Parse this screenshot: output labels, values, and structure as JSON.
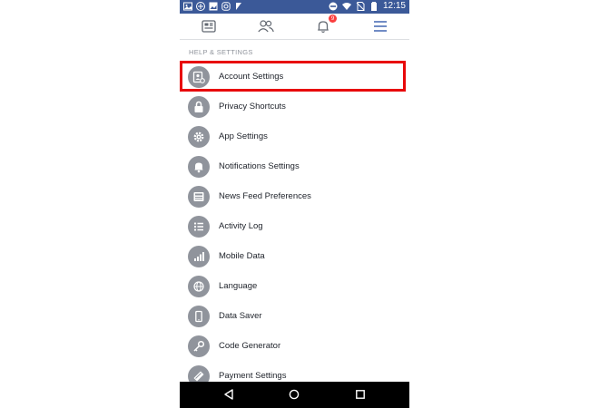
{
  "status_bar": {
    "time": "12:15",
    "left_icons": [
      "gallery-icon",
      "game-icon",
      "photo-icon",
      "instagram-icon",
      "download-icon"
    ],
    "right_icons": [
      "do-not-disturb-icon",
      "wifi-icon",
      "no-sim-icon",
      "battery-icon"
    ]
  },
  "nav": {
    "items": [
      {
        "name": "news-feed-tab",
        "icon": "news-feed-icon"
      },
      {
        "name": "friends-tab",
        "icon": "friends-icon"
      },
      {
        "name": "notifications-tab",
        "icon": "bell-icon",
        "badge": "9"
      },
      {
        "name": "menu-tab",
        "icon": "hamburger-menu-icon",
        "active": true
      }
    ],
    "active_color": "#4267b2"
  },
  "section": {
    "title": "HELP & SETTINGS"
  },
  "menu": {
    "items": [
      {
        "label": "Account Settings",
        "icon": "account-settings-icon"
      },
      {
        "label": "Privacy Shortcuts",
        "icon": "lock-icon"
      },
      {
        "label": "App Settings",
        "icon": "gear-icon"
      },
      {
        "label": "Notifications Settings",
        "icon": "bell-icon"
      },
      {
        "label": "News Feed Preferences",
        "icon": "news-feed-icon"
      },
      {
        "label": "Activity Log",
        "icon": "list-icon"
      },
      {
        "label": "Mobile Data",
        "icon": "signal-bars-icon"
      },
      {
        "label": "Language",
        "icon": "globe-icon"
      },
      {
        "label": "Data Saver",
        "icon": "phone-icon"
      },
      {
        "label": "Code Generator",
        "icon": "key-icon"
      },
      {
        "label": "Payment Settings",
        "icon": "card-icon"
      }
    ]
  },
  "highlight_color": "#e8080a",
  "android_nav": {
    "buttons": [
      "back-icon",
      "home-icon",
      "recents-icon"
    ]
  }
}
